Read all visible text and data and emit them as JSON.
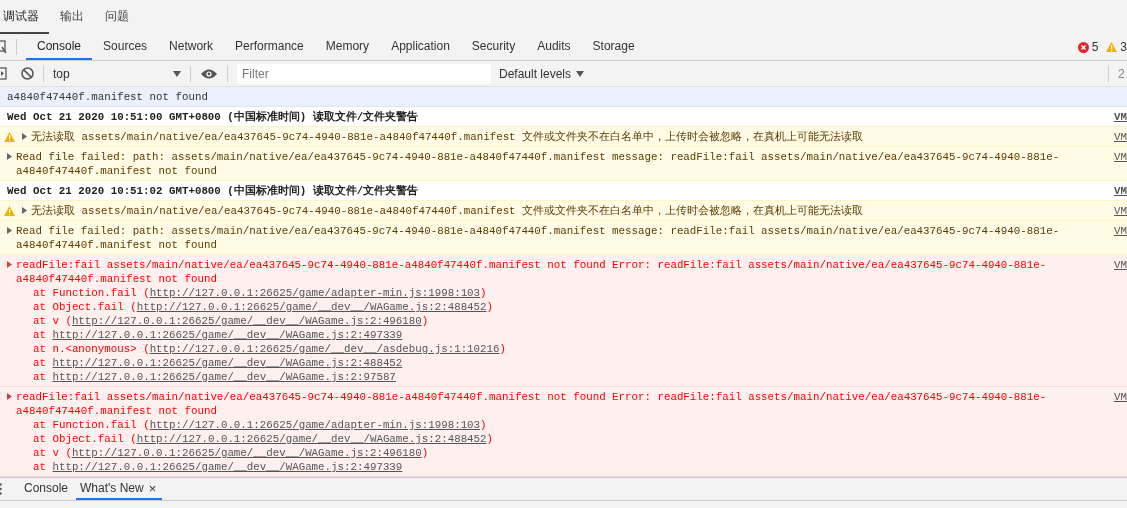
{
  "panel_tabs": [
    {
      "label": "调试器",
      "selected": true
    },
    {
      "label": "输出",
      "selected": false
    },
    {
      "label": "问题",
      "selected": false
    }
  ],
  "devtools_tabs": [
    {
      "label": "Console",
      "selected": true
    },
    {
      "label": "Sources",
      "selected": false
    },
    {
      "label": "Network",
      "selected": false
    },
    {
      "label": "Performance",
      "selected": false
    },
    {
      "label": "Memory",
      "selected": false
    },
    {
      "label": "Application",
      "selected": false
    },
    {
      "label": "Security",
      "selected": false
    },
    {
      "label": "Audits",
      "selected": false
    },
    {
      "label": "Storage",
      "selected": false
    }
  ],
  "counts": {
    "errors": "5",
    "warnings": "3"
  },
  "toolbar": {
    "context": "top",
    "filter_placeholder": "Filter",
    "levels": "Default levels",
    "hidden_count": "2"
  },
  "messages": [
    {
      "kind": "log",
      "highlighted": true,
      "expandable": false,
      "text": "a4840f47440f.manifest not found"
    },
    {
      "kind": "heading",
      "highlighted": false,
      "expandable": false,
      "text": "Wed Oct 21 2020 10:51:00 GMT+0800 (中国标准时间) 读取文件/文件夹警告",
      "source": "VM"
    },
    {
      "kind": "warning",
      "highlighted": false,
      "text": "无法读取 assets/main/native/ea/ea437645-9c74-4940-881e-a4840f47440f.manifest 文件或文件夹不在白名单中，上传时会被忽略，在真机上可能无法读取",
      "source": "VM"
    },
    {
      "kind": "log",
      "highlighted": false,
      "text": "Read file failed: path: assets/main/native/ea/ea437645-9c74-4940-881e-a4840f47440f.manifest message: readFile:fail assets/main/native/ea/ea437645-9c74-4940-881e-a4840f47440f.manifest not found",
      "source": "VM"
    },
    {
      "kind": "heading",
      "highlighted": false,
      "expandable": false,
      "text": "Wed Oct 21 2020 10:51:02 GMT+0800 (中国标准时间) 读取文件/文件夹警告",
      "source": "VM"
    },
    {
      "kind": "warning",
      "highlighted": false,
      "text": "无法读取 assets/main/native/ea/ea437645-9c74-4940-881e-a4840f47440f.manifest 文件或文件夹不在白名单中，上传时会被忽略，在真机上可能无法读取",
      "source": "VM"
    },
    {
      "kind": "log",
      "highlighted": false,
      "text": "Read file failed: path: assets/main/native/ea/ea437645-9c74-4940-881e-a4840f47440f.manifest message: readFile:fail assets/main/native/ea/ea437645-9c74-4940-881e-a4840f47440f.manifest not found",
      "source": "VM"
    },
    {
      "kind": "error",
      "highlighted": false,
      "text": "readFile:fail assets/main/native/ea/ea437645-9c74-4940-881e-a4840f47440f.manifest not found Error: readFile:fail assets/main/native/ea/ea437645-9c74-4940-881e-a4840f47440f.manifest not found",
      "source": "VM",
      "stack": [
        {
          "prefix": "at Function.fail (",
          "url": "http://127.0.0.1:26625/game/adapter-min.js:1998:103",
          "suffix": ")"
        },
        {
          "prefix": "at Object.fail (",
          "url": "http://127.0.0.1:26625/game/__dev__/WAGame.js:2:488452",
          "suffix": ")"
        },
        {
          "prefix": "at v (",
          "url": "http://127.0.0.1:26625/game/__dev__/WAGame.js:2:496180",
          "suffix": ")"
        },
        {
          "prefix": "at ",
          "url": "http://127.0.0.1:26625/game/__dev__/WAGame.js:2:497339"
        },
        {
          "prefix": "at n.<anonymous> (",
          "url": "http://127.0.0.1:26625/game/__dev__/asdebug.js:1:10216",
          "suffix": ")"
        },
        {
          "prefix": "at ",
          "url": "http://127.0.0.1:26625/game/__dev__/WAGame.js:2:488452"
        },
        {
          "prefix": "at ",
          "url": "http://127.0.0.1:26625/game/__dev__/WAGame.js:2:97587"
        }
      ]
    },
    {
      "kind": "error",
      "highlighted": false,
      "text": "readFile:fail assets/main/native/ea/ea437645-9c74-4940-881e-a4840f47440f.manifest not found Error: readFile:fail assets/main/native/ea/ea437645-9c74-4940-881e-a4840f47440f.manifest not found",
      "source": "VM",
      "stack": [
        {
          "prefix": "at Function.fail (",
          "url": "http://127.0.0.1:26625/game/adapter-min.js:1998:103",
          "suffix": ")"
        },
        {
          "prefix": "at Object.fail (",
          "url": "http://127.0.0.1:26625/game/__dev__/WAGame.js:2:488452",
          "suffix": ")"
        },
        {
          "prefix": "at v (",
          "url": "http://127.0.0.1:26625/game/__dev__/WAGame.js:2:496180",
          "suffix": ")"
        },
        {
          "prefix": "at ",
          "url": "http://127.0.0.1:26625/game/__dev__/WAGame.js:2:497339"
        }
      ]
    }
  ],
  "drawer_tabs": [
    {
      "label": "Console",
      "selected": false
    },
    {
      "label": "What's New",
      "selected": true,
      "close": "×"
    }
  ]
}
